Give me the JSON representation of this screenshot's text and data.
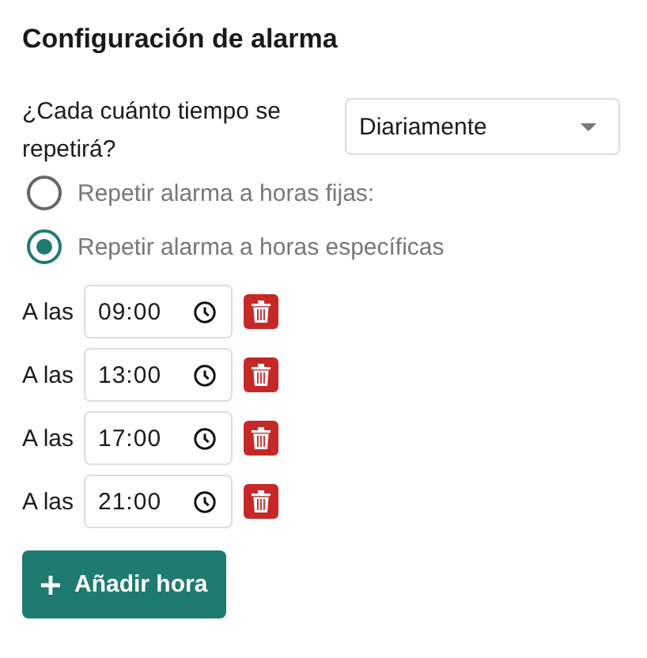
{
  "title": "Configuración de alarma",
  "repeat": {
    "label": "¿Cada cuánto tiempo se repetirá?",
    "value": "Diariamente"
  },
  "modes": [
    {
      "label": "Repetir alarma a horas fijas:",
      "selected": false
    },
    {
      "label": "Repetir alarma a horas específicas",
      "selected": true
    }
  ],
  "times": [
    {
      "prefix": "A las",
      "value": "09:00"
    },
    {
      "prefix": "A las",
      "value": "13:00"
    },
    {
      "prefix": "A las",
      "value": "17:00"
    },
    {
      "prefix": "A las",
      "value": "21:00"
    }
  ],
  "add_button": "Añadir hora"
}
